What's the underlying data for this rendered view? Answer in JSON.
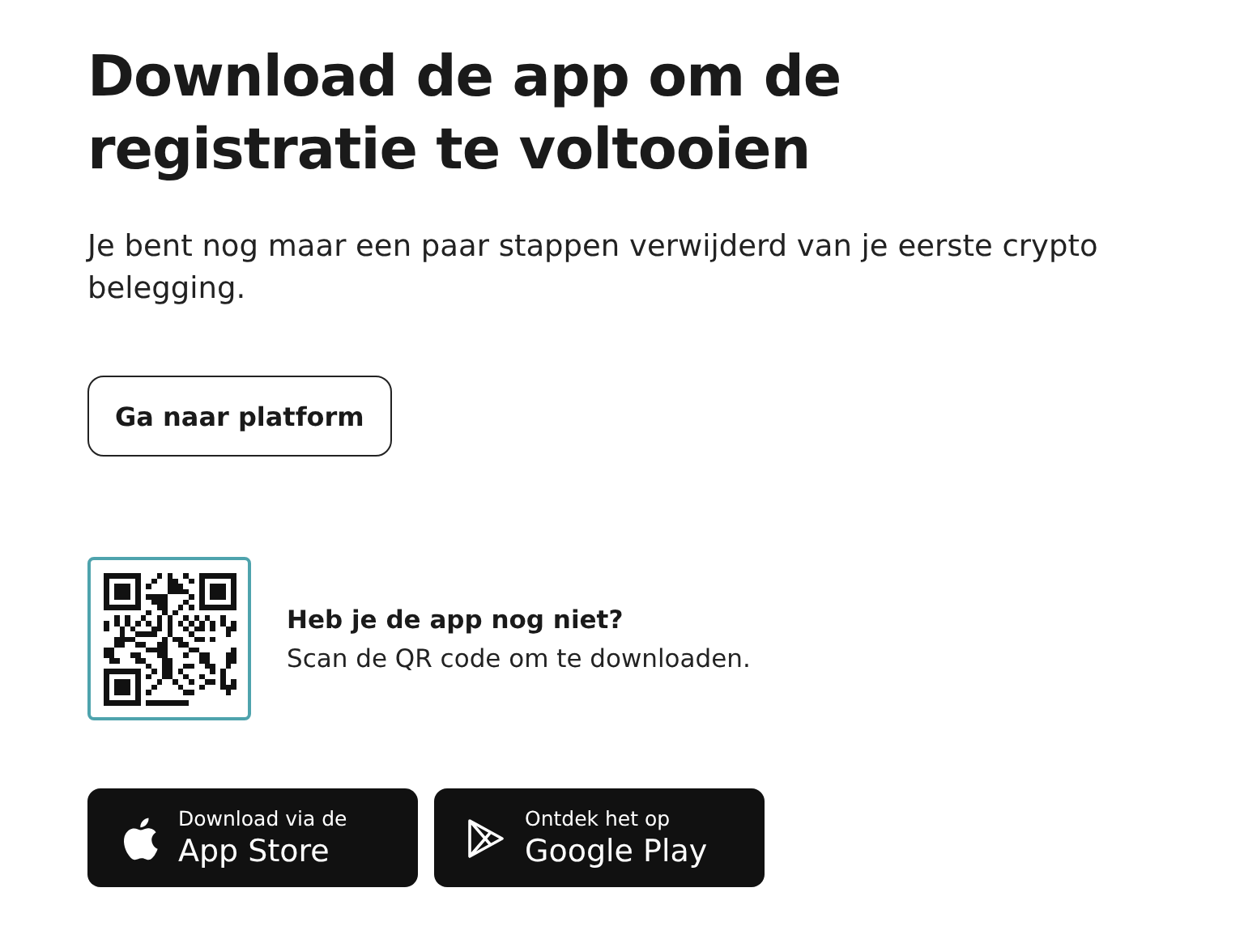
{
  "heading": "Download de app om de registratie te voltooien",
  "intro": "Je bent nog maar een paar stappen verwijderd van je eerste crypto belegging.",
  "platform_button": "Ga naar platform",
  "qr_section": {
    "title": "Heb je de app nog niet?",
    "text": "Scan de QR code om te downloaden."
  },
  "store_buttons": [
    {
      "kind": "apple",
      "caption": "Download via de",
      "store": "App Store"
    },
    {
      "kind": "google",
      "caption": "Ontdek het op",
      "store": "Google Play"
    }
  ]
}
